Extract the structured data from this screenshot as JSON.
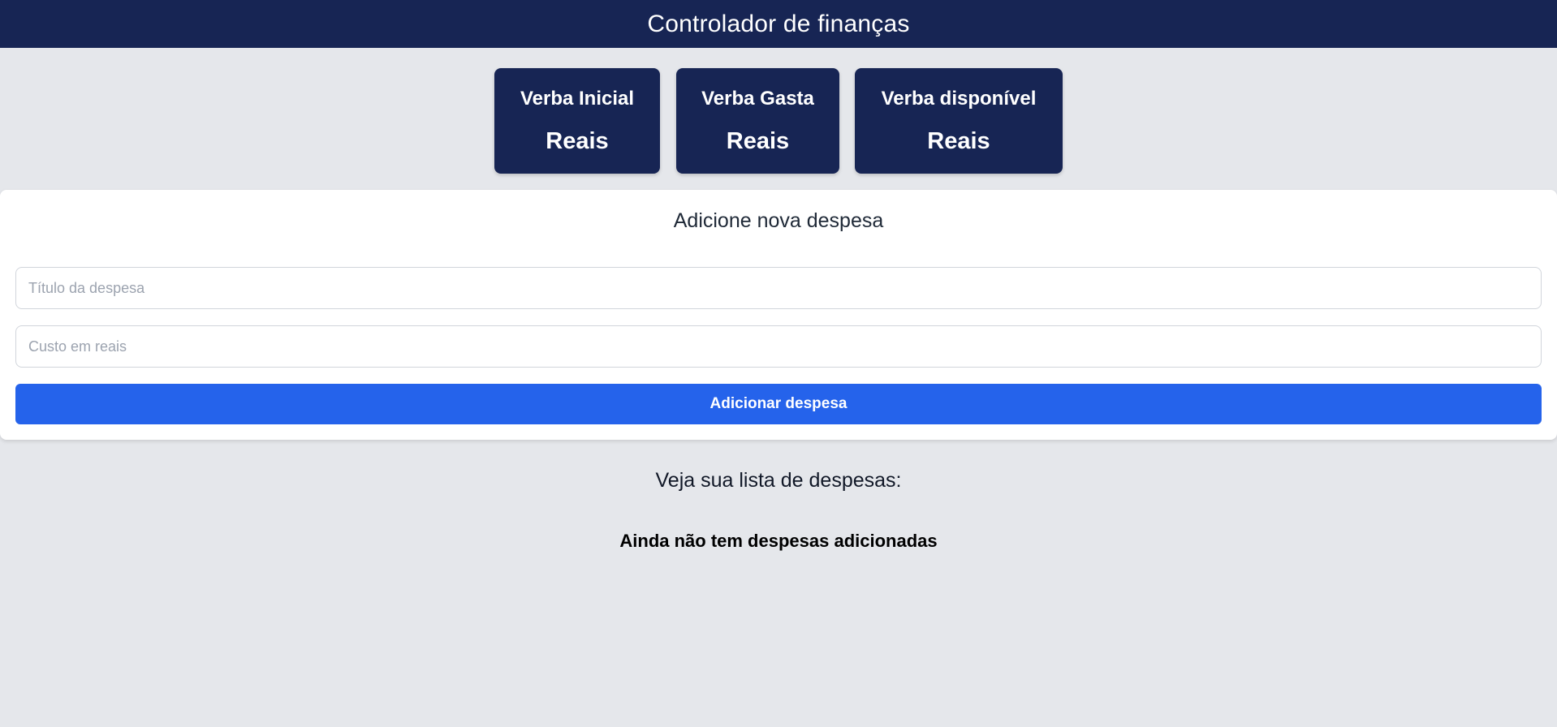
{
  "header": {
    "title": "Controlador de finanças"
  },
  "summary": {
    "cards": [
      {
        "label": "Verba Inicial",
        "value": "Reais"
      },
      {
        "label": "Verba Gasta",
        "value": "Reais"
      },
      {
        "label": "Verba disponível",
        "value": "Reais"
      }
    ]
  },
  "form": {
    "title": "Adicione nova despesa",
    "title_field": {
      "placeholder": "Título da despesa",
      "value": ""
    },
    "cost_field": {
      "placeholder": "Custo em reais",
      "value": ""
    },
    "submit_label": "Adicionar despesa"
  },
  "list": {
    "heading": "Veja sua lista de despesas:",
    "empty_message": "Ainda não tem despesas adicionadas"
  },
  "colors": {
    "header_bg": "#172554",
    "card_bg": "#172554",
    "accent": "#2563eb",
    "page_bg": "#e5e7eb"
  }
}
